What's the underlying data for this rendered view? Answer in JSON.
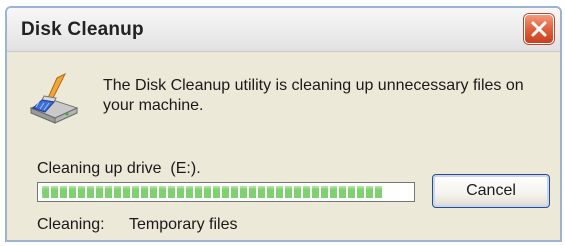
{
  "window": {
    "title": "Disk Cleanup"
  },
  "titlebar": {
    "close_icon": "close-icon"
  },
  "content": {
    "app_icon": "disk-cleanup-icon",
    "message": "The Disk Cleanup utility is cleaning up unnecessary files on your machine.",
    "drive_label": "Cleaning up drive  (E:).",
    "progress": 0.93,
    "cancel_label": "Cancel",
    "status_label": "Cleaning:",
    "status_value": "Temporary files"
  },
  "colors": {
    "progress_fill": "#7fd06e",
    "close_button": "#e0603c",
    "dialog_background": "#ece9d8"
  }
}
